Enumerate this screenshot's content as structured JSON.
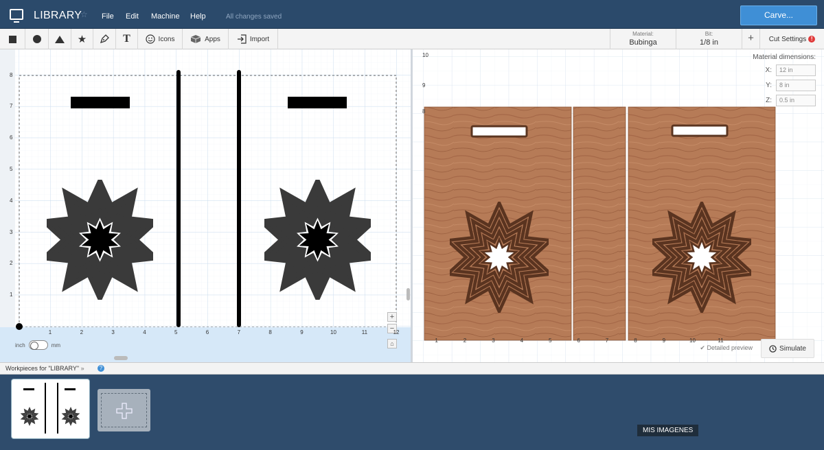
{
  "header": {
    "title": "LIBRARY",
    "star": "☆",
    "menus": [
      "File",
      "Edit",
      "Machine",
      "Help"
    ],
    "saved_status": "All changes saved",
    "carve_label": "Carve..."
  },
  "toolbar": {
    "icons_label": "Icons",
    "apps_label": "Apps",
    "import_label": "Import",
    "material_label": "Material:",
    "material_value": "Bubinga",
    "bit_label": "Bit:",
    "bit_value": "1/8 in",
    "plus": "+",
    "cut_settings_label": "Cut Settings",
    "cut_settings_badge": "!"
  },
  "design_canvas": {
    "x_ticks": [
      "1",
      "2",
      "3",
      "4",
      "5",
      "6",
      "7",
      "8",
      "9",
      "10",
      "11",
      "12"
    ],
    "y_ticks": [
      "1",
      "2",
      "3",
      "4",
      "5",
      "6",
      "7",
      "8"
    ],
    "unit_left": "inch",
    "unit_right": "mm",
    "zoom_in": "+",
    "zoom_out": "−"
  },
  "preview": {
    "material_dims_title": "Material dimensions:",
    "x_label": "X:",
    "x_value": "12 in",
    "y_label": "Y:",
    "y_value": "8 in",
    "z_label": "Z:",
    "z_value": "0.5 in",
    "x_ticks": [
      "1",
      "2",
      "3",
      "4",
      "5",
      "6",
      "7",
      "8",
      "9",
      "10",
      "11"
    ],
    "y_ticks": [
      "8",
      "9",
      "10"
    ],
    "detailed_preview": "Detailed preview",
    "simulate_label": "Simulate",
    "wood_color": "#b87a55"
  },
  "workpieces": {
    "label": "Workpieces for \"LIBRARY\"",
    "chevron": "»",
    "help": "?"
  },
  "tooltip": "MIS IMAGENES"
}
